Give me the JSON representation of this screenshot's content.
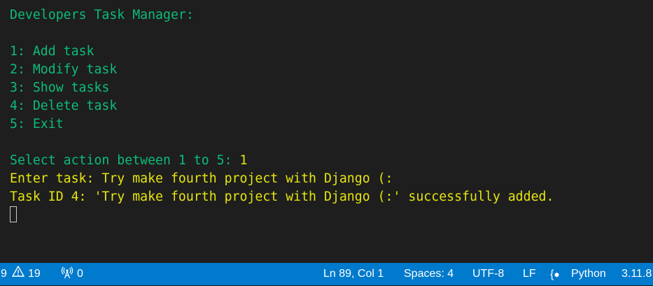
{
  "terminal": {
    "title": "Developers Task Manager:",
    "menu": [
      "1: Add task",
      "2: Modify task",
      "3: Show tasks",
      "4: Delete task",
      "5: Exit"
    ],
    "prompt": "Select action between 1 to 5: ",
    "prompt_input": "1",
    "enter_task": "Enter task: Try make fourth project with Django (:",
    "result": "Task ID 4: 'Try make fourth project with Django (:' successfully added."
  },
  "statusbar": {
    "errors": "9",
    "warnings": "19",
    "ports": "0",
    "position": "Ln 89, Col 1",
    "spaces": "Spaces: 4",
    "encoding": "UTF-8",
    "eol": "LF",
    "language": "Python",
    "interpreter": "3.11.8"
  },
  "colors": {
    "background": "#1e1e1e",
    "green": "#0dbc79",
    "yellow": "#e5e510",
    "statusbar": "#007acc"
  }
}
